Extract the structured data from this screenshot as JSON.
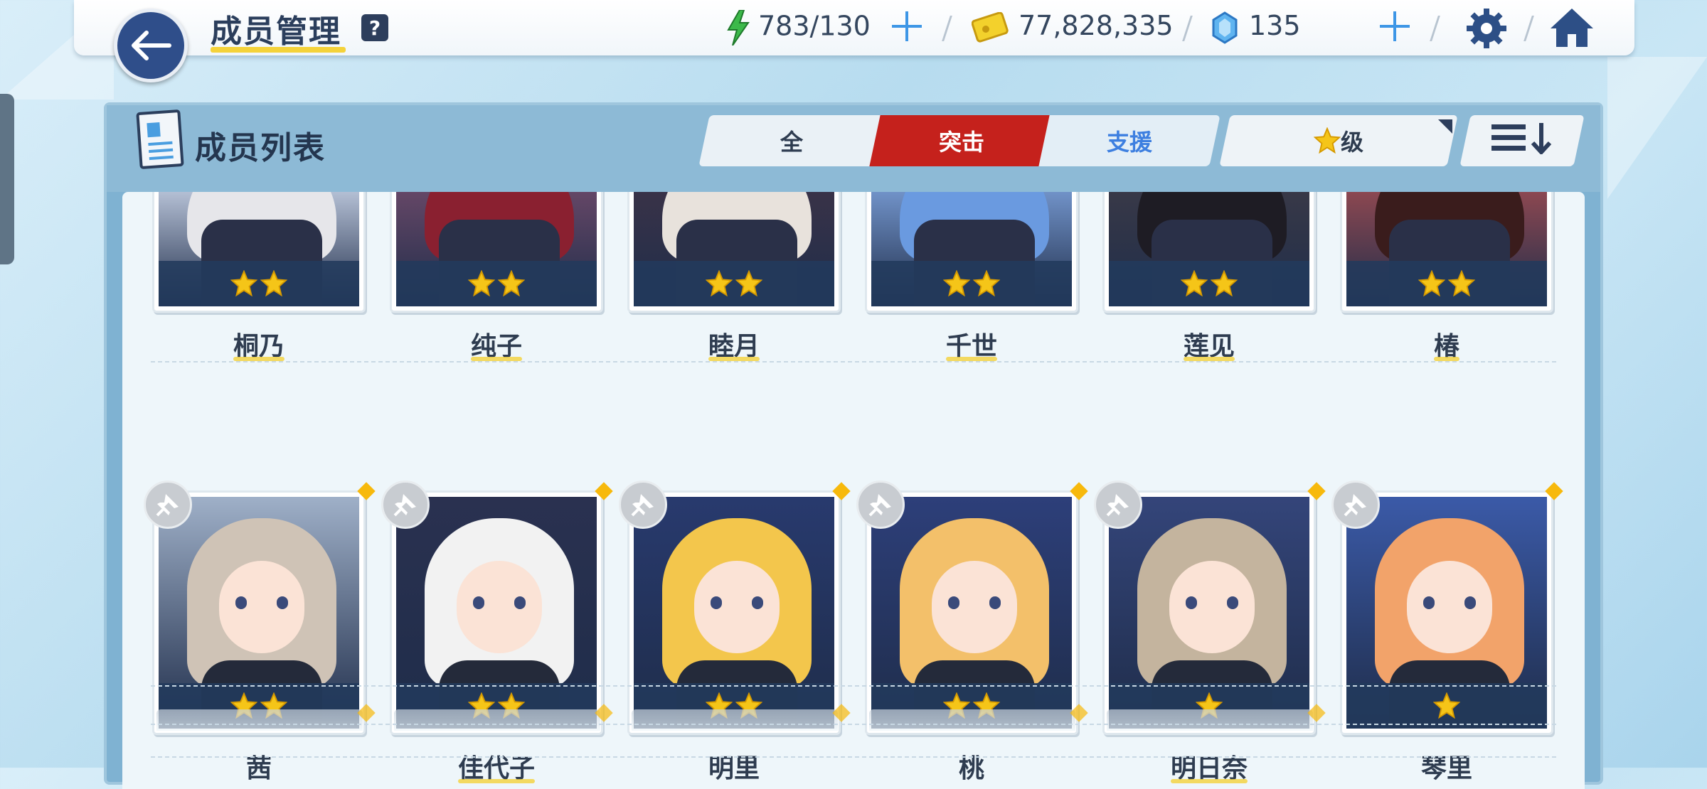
{
  "header": {
    "title": "成员管理",
    "help_label": "?",
    "stamina": "783/130",
    "credits": "77,828,335",
    "gems": "135"
  },
  "panel": {
    "title": "成员列表",
    "tabs": [
      {
        "label": "全",
        "active": false
      },
      {
        "label": "突击",
        "active": true
      },
      {
        "label": "支援",
        "active": false
      }
    ],
    "sort_label": "级"
  },
  "rows": [
    {
      "cards": [
        {
          "name": "桐乃",
          "stars": 2
        },
        {
          "name": "纯子",
          "stars": 2
        },
        {
          "name": "睦月",
          "stars": 2
        },
        {
          "name": "千世",
          "stars": 2
        },
        {
          "name": "莲见",
          "stars": 2
        },
        {
          "name": "椿",
          "stars": 2
        }
      ]
    },
    {
      "cards": [
        {
          "name": "茜",
          "stars": 2
        },
        {
          "name": "佳代子",
          "stars": 2
        },
        {
          "name": "明里",
          "stars": 2
        },
        {
          "name": "桃",
          "stars": 2
        },
        {
          "name": "明日奈",
          "stars": 1
        },
        {
          "name": "琴里",
          "stars": 1
        }
      ]
    }
  ],
  "colors": {
    "accent_red": "#c5211c",
    "support_blue": "#3d7fe0",
    "star_yellow": "#f5c518",
    "navy": "#2f4e8a"
  }
}
